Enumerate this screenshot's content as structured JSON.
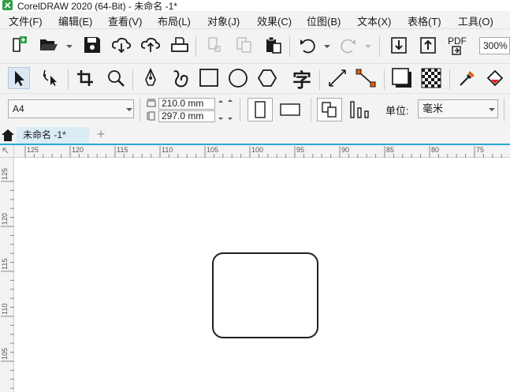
{
  "window": {
    "title": "CorelDRAW 2020 (64-Bit) - 未命名 -1*"
  },
  "menu": [
    {
      "label": "文件(F)"
    },
    {
      "label": "编辑(E)"
    },
    {
      "label": "查看(V)"
    },
    {
      "label": "布局(L)"
    },
    {
      "label": "对象(J)"
    },
    {
      "label": "效果(C)"
    },
    {
      "label": "位图(B)"
    },
    {
      "label": "文本(X)"
    },
    {
      "label": "表格(T)"
    },
    {
      "label": "工具(O)"
    }
  ],
  "toolbar": {
    "pdf_label": "PDF",
    "zoom": "300%",
    "icons": [
      "new-document-icon",
      "open-folder-icon",
      "save-icon",
      "cloud-download-icon",
      "cloud-upload-icon",
      "print-icon",
      "cut-icon",
      "copy-icon",
      "paste-icon",
      "undo-icon",
      "redo-icon",
      "import-icon",
      "export-icon",
      "publish-pdf-icon"
    ]
  },
  "toolbox": {
    "text_tool_glyph": "字",
    "icons": [
      "pick-tool-icon",
      "shape-tool-icon",
      "crop-tool-icon",
      "zoom-tool-icon",
      "pen-tool-icon",
      "freehand-tool-icon",
      "rectangle-tool-icon",
      "ellipse-tool-icon",
      "polygon-tool-icon",
      "text-tool-icon",
      "parallel-dimension-icon",
      "connector-tool-icon",
      "drop-shadow-icon",
      "transparency-icon",
      "eyedropper-icon",
      "fill-icon"
    ]
  },
  "property_bar": {
    "page_size": "A4",
    "width": "210.0 mm",
    "height": "297.0 mm",
    "units_label": "单位:",
    "units_value": "毫米"
  },
  "tabs": {
    "document_tab": "未命名 -1*",
    "add_tab": "+"
  },
  "rulers": {
    "horizontal_labels": [
      "125",
      "120",
      "115",
      "110",
      "105",
      "100",
      "95",
      "90",
      "85",
      "80",
      "75"
    ],
    "vertical_labels": [
      "125",
      "120",
      "115",
      "110",
      "105"
    ]
  },
  "colors": {
    "accent": "#29a8d8",
    "logo": "#2f9e44",
    "shape_stroke": "#231f20"
  }
}
